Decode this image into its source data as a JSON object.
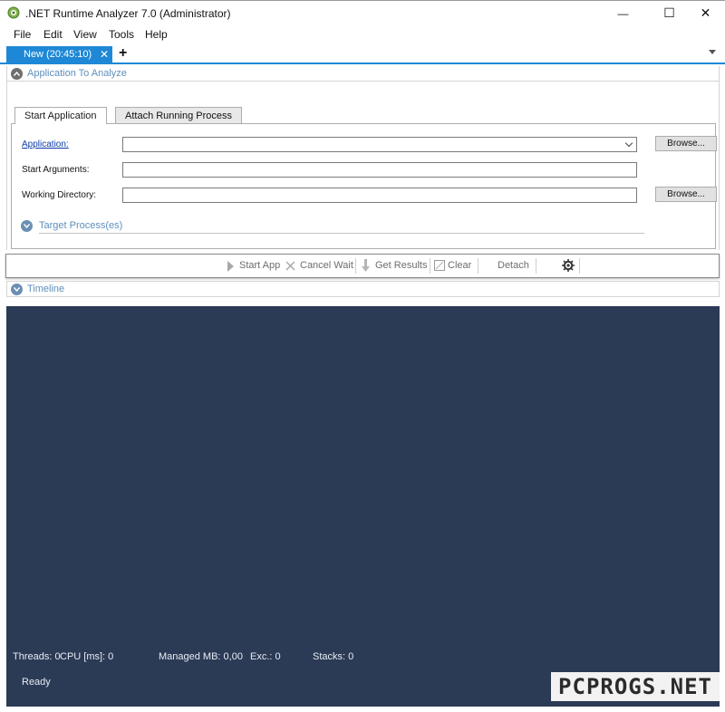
{
  "window": {
    "title": ".NET Runtime Analyzer 7.0 (Administrator)",
    "minimize_glyph": "—",
    "maximize_glyph": "☐",
    "close_glyph": "✕"
  },
  "menu": [
    "File",
    "Edit",
    "View",
    "Tools",
    "Help"
  ],
  "doc_tabs": {
    "active_label": "New (20:45:10)",
    "close_glyph": "✕",
    "new_glyph": "+"
  },
  "app_section": {
    "title": "Application To Analyze",
    "tabs": [
      "Start Application",
      "Attach Running Process"
    ],
    "active_tab": "Start Application",
    "fields": {
      "application_label": "Application:",
      "application_value": "",
      "start_args_label": "Start Arguments:",
      "start_args_value": "",
      "working_dir_label": "Working Directory:",
      "working_dir_value": ""
    },
    "browse_label": "Browse...",
    "target_process_label": "Target Process(es)"
  },
  "toolbar": {
    "start_app": "Start App",
    "cancel_wait": "Cancel Wait",
    "get_results": "Get Results",
    "clear": "Clear",
    "detach": "Detach"
  },
  "timeline": {
    "title": "Timeline"
  },
  "status": {
    "threads": "Threads: 0",
    "cpu": "CPU [ms]: 0",
    "managed_mb": "Managed MB: 0,00",
    "exc": "Exc.: 0",
    "stacks": "Stacks: 0",
    "ready": "Ready"
  },
  "watermark": "PCPROGS.NET",
  "colors": {
    "accent": "#1e88d6",
    "timeline_bg": "#2b3a55",
    "section_icon": "#6b8fb3"
  }
}
